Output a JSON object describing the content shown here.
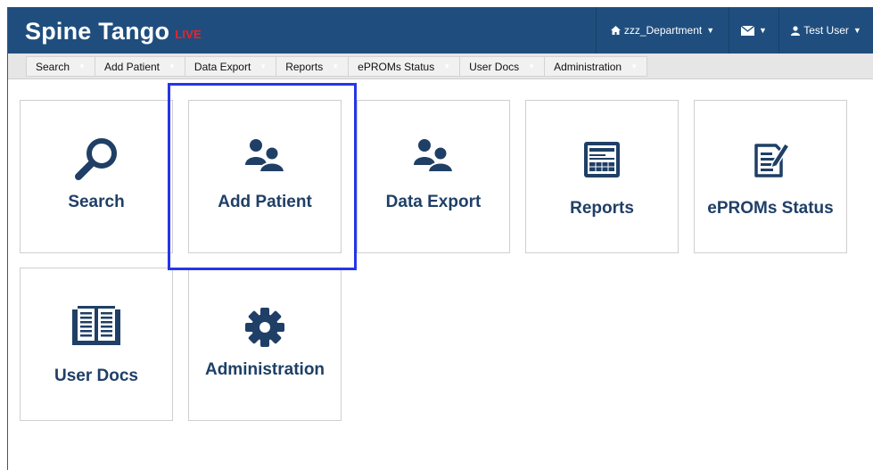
{
  "app": {
    "brand": "Spine Tango",
    "badge": "LIVE"
  },
  "topbar": {
    "department": "zzz_Department",
    "department_icon": "home-icon",
    "mail_icon": "envelope-icon",
    "user": "Test User",
    "user_icon": "user-icon"
  },
  "menu": [
    {
      "label": "Search"
    },
    {
      "label": "Add Patient"
    },
    {
      "label": "Data Export"
    },
    {
      "label": "Reports"
    },
    {
      "label": "ePROMs Status"
    },
    {
      "label": "User Docs"
    },
    {
      "label": "Administration"
    }
  ],
  "tiles": [
    {
      "label": "Search",
      "icon": "magnifier-icon"
    },
    {
      "label": "Add Patient",
      "icon": "users-icon"
    },
    {
      "label": "Data Export",
      "icon": "users-icon"
    },
    {
      "label": "Reports",
      "icon": "report-icon"
    },
    {
      "label": "ePROMs Status",
      "icon": "edit-document-icon"
    },
    {
      "label": "User Docs",
      "icon": "book-icon"
    },
    {
      "label": "Administration",
      "icon": "gear-icon"
    }
  ],
  "colors": {
    "header": "#1f4e7e",
    "accent_live": "#e8242a",
    "tile_label": "#1f3f66",
    "highlight": "#2536e8"
  },
  "highlighted_tile": "Add Patient"
}
